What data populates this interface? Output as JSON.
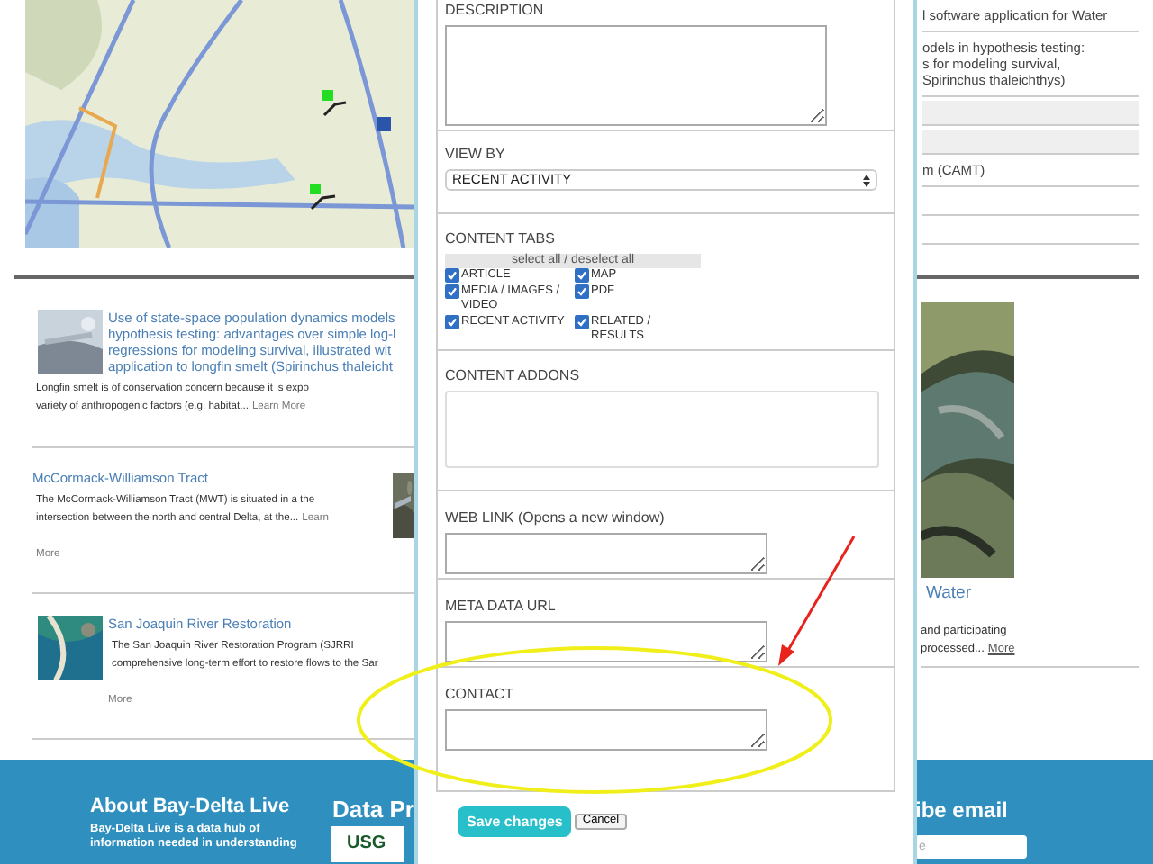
{
  "right_top": [
    {
      "kind": "text",
      "lines": [
        "l software application for Water"
      ]
    },
    {
      "kind": "text",
      "lines": [
        "odels in hypothesis testing:",
        "s for modeling survival,",
        "Spirinchus thaleichthys)"
      ]
    },
    {
      "kind": "shaded"
    },
    {
      "kind": "shaded"
    },
    {
      "kind": "text",
      "lines": [
        "m (CAMT)"
      ]
    },
    {
      "kind": "blank"
    },
    {
      "kind": "blank"
    }
  ],
  "articles": [
    {
      "kind": "thumb_left",
      "title_lines": [
        "Use of state-space population dynamics models",
        "hypothesis testing: advantages over simple log-l",
        "regressions for modeling survival, illustrated wit",
        "application to longfin smelt (Spirinchus thaleicht"
      ],
      "description_lines": [
        "Longfin smelt is of conservation concern because it is expo",
        "variety of anthropogenic factors (e.g. habitat..."
      ],
      "inline_link": "Learn More"
    },
    {
      "kind": "thumb_right",
      "title_lines": [
        "McCormack-Williamson Tract"
      ],
      "description_lines": [
        "The McCormack-Williamson Tract (MWT) is situated in a the",
        "intersection between the north and central Delta, at the..."
      ],
      "inline_link": "Learn",
      "link_lines": [
        "More"
      ]
    },
    {
      "kind": "thumb_left",
      "title_lines": [
        "San Joaquin River Restoration"
      ],
      "description_lines": [
        "The San Joaquin River Restoration Program (SJRRI",
        "comprehensive long-term effort to restore flows to the Sar"
      ],
      "link_lines": [
        "More"
      ]
    }
  ],
  "feature": {
    "link": "Water",
    "lines": [
      "and participating",
      "processed..."
    ],
    "more": "More"
  },
  "footer": {
    "about_title": "About Bay-Delta Live",
    "about_lines": [
      "Bay-Delta Live is a data hub of",
      "information needed in understanding"
    ],
    "data_title": "Data Pr",
    "logo_text": "USG",
    "subscribe_title": "ibe email",
    "email_placeholder": "e"
  },
  "form": {
    "sections": [
      {
        "kind": "tall_text",
        "label": "DESCRIPTION"
      },
      {
        "kind": "select",
        "label": "VIEW BY",
        "value": "RECENT ACTIVITY"
      },
      {
        "kind": "checklist",
        "label": "CONTENT TABS",
        "toggle_all": "select all / deselect all",
        "options": [
          {
            "label": "ARTICLE",
            "checked": true
          },
          {
            "label": "MAP",
            "checked": true
          },
          {
            "label": "MEDIA / IMAGES / VIDEO",
            "checked": true
          },
          {
            "label": "PDF",
            "checked": true
          },
          {
            "label": "RECENT ACTIVITY",
            "checked": true
          },
          {
            "label": "RELATED / RESULTS",
            "checked": true
          }
        ]
      },
      {
        "kind": "box_text",
        "label": "CONTENT ADDONS"
      },
      {
        "kind": "short_text",
        "label": "WEB LINK (Opens a new window)"
      },
      {
        "kind": "short_text",
        "label": "META DATA URL"
      },
      {
        "kind": "short_text",
        "label": "CONTACT"
      }
    ],
    "save": "Save changes",
    "cancel": "Cancel"
  }
}
